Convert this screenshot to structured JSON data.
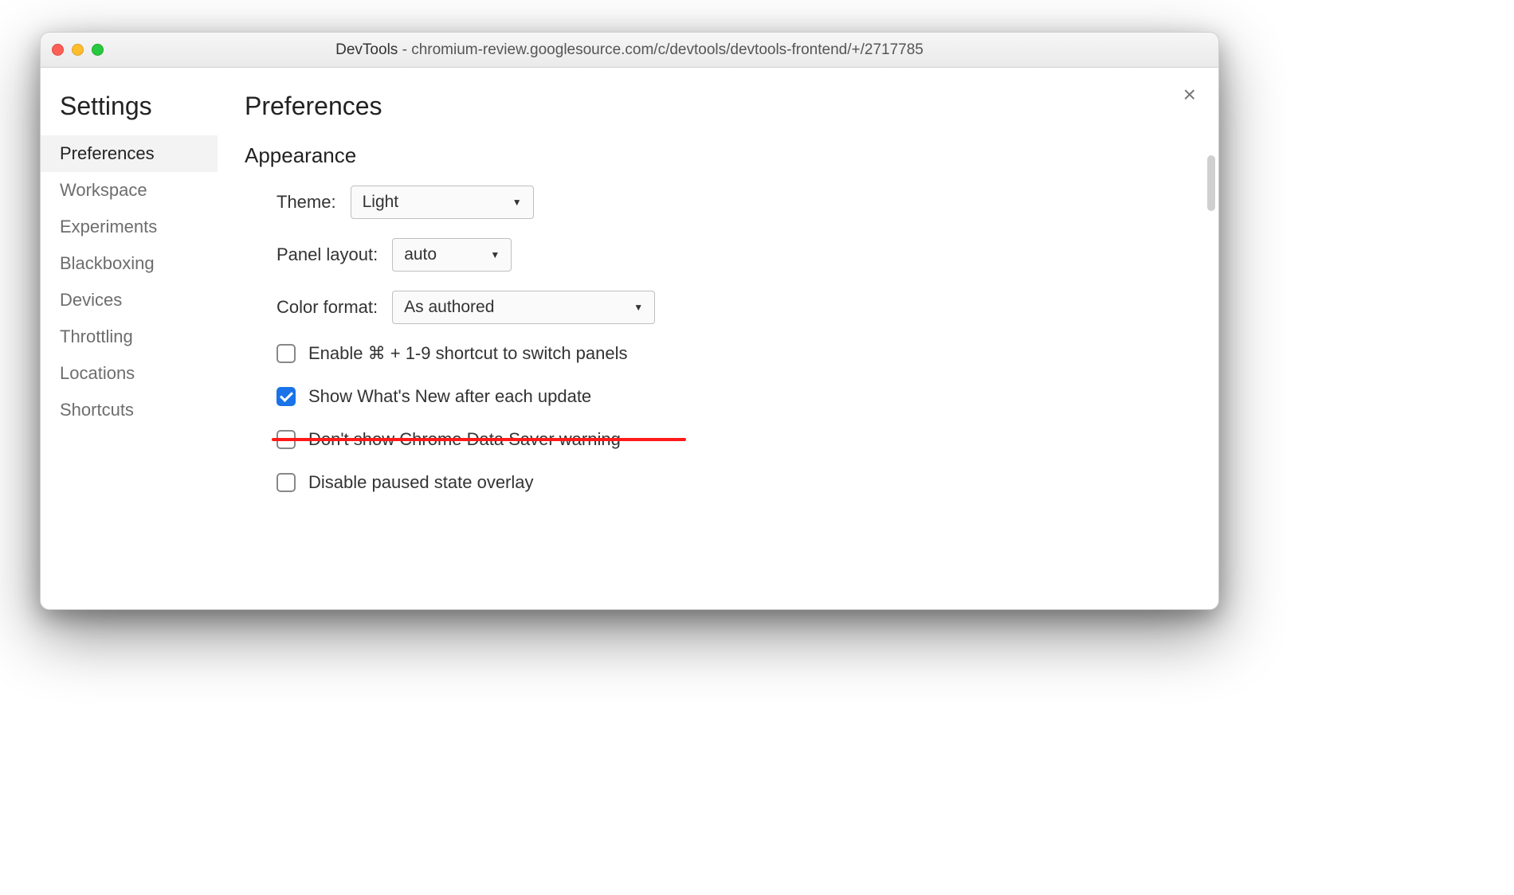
{
  "window": {
    "title_label": "DevTools",
    "title_path": "chromium-review.googlesource.com/c/devtools/devtools-frontend/+/2717785"
  },
  "close_label": "×",
  "sidebar": {
    "title": "Settings",
    "items": [
      {
        "label": "Preferences",
        "active": true
      },
      {
        "label": "Workspace",
        "active": false
      },
      {
        "label": "Experiments",
        "active": false
      },
      {
        "label": "Blackboxing",
        "active": false
      },
      {
        "label": "Devices",
        "active": false
      },
      {
        "label": "Throttling",
        "active": false
      },
      {
        "label": "Locations",
        "active": false
      },
      {
        "label": "Shortcuts",
        "active": false
      }
    ]
  },
  "main": {
    "title": "Preferences",
    "section": "Appearance",
    "theme_label": "Theme:",
    "theme_value": "Light",
    "layout_label": "Panel layout:",
    "layout_value": "auto",
    "color_label": "Color format:",
    "color_value": "As authored",
    "checks": [
      {
        "label": "Enable ⌘ + 1-9 shortcut to switch panels",
        "checked": false,
        "struck": false
      },
      {
        "label": "Show What's New after each update",
        "checked": true,
        "struck": false
      },
      {
        "label": "Don't show Chrome Data Saver warning",
        "checked": false,
        "struck": true
      },
      {
        "label": "Disable paused state overlay",
        "checked": false,
        "struck": false
      }
    ]
  }
}
